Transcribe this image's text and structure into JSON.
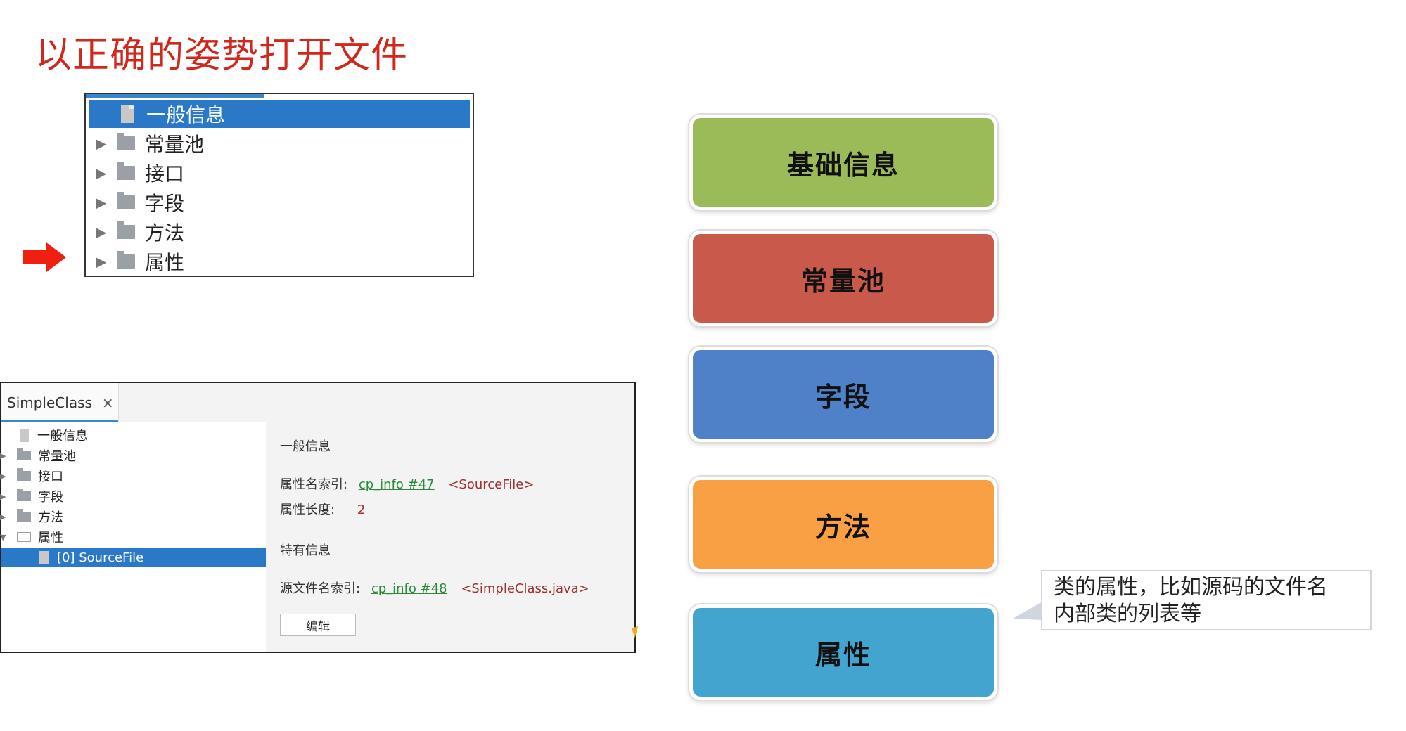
{
  "title": "以正确的姿势打开文件",
  "top_tree": {
    "items": [
      {
        "label": "一般信息",
        "type": "doc",
        "selected": true,
        "expandable": false
      },
      {
        "label": "常量池",
        "type": "folder",
        "selected": false,
        "expandable": true
      },
      {
        "label": "接口",
        "type": "folder",
        "selected": false,
        "expandable": true
      },
      {
        "label": "字段",
        "type": "folder",
        "selected": false,
        "expandable": true
      },
      {
        "label": "方法",
        "type": "folder",
        "selected": false,
        "expandable": true
      },
      {
        "label": "属性",
        "type": "folder",
        "selected": false,
        "expandable": true
      }
    ],
    "expander_glyph": "▶"
  },
  "window": {
    "tab_label": "SimpleClass",
    "tab_close": "×",
    "tree": [
      {
        "label": "一般信息",
        "type": "doc"
      },
      {
        "label": "常量池",
        "type": "folder",
        "expander": "▶"
      },
      {
        "label": "接口",
        "type": "folder",
        "expander": "▶"
      },
      {
        "label": "字段",
        "type": "folder",
        "expander": "▶"
      },
      {
        "label": "方法",
        "type": "folder",
        "expander": "▶"
      },
      {
        "label": "属性",
        "type": "folder-open",
        "expander": "▼"
      },
      {
        "label": "[0] SourceFile",
        "type": "doc",
        "selected": true
      }
    ],
    "general_section": "一般信息",
    "attr_name_index_label": "属性名索引:",
    "attr_name_index_link": "cp_info #47",
    "attr_name_index_value": "<SourceFile>",
    "attr_length_label": "属性长度:",
    "attr_length_value": "2",
    "specific_section": "特有信息",
    "source_file_index_label": "源文件名索引:",
    "source_file_index_link": "cp_info #48",
    "source_file_index_value": "<SimpleClass.java>",
    "edit_button": "编辑"
  },
  "blocks": [
    {
      "label": "基础信息",
      "color": "#9bbb59"
    },
    {
      "label": "常量池",
      "color": "#c9594a"
    },
    {
      "label": "字段",
      "color": "#4f81c8"
    },
    {
      "label": "方法",
      "color": "#f9a045"
    },
    {
      "label": "属性",
      "color": "#43a5cf"
    }
  ],
  "callout": {
    "line1": "类的属性，比如源码的文件名",
    "line2": "内部类的列表等"
  },
  "colors": {
    "title": "#d0281c",
    "selection": "#2a78c8",
    "arrow": "#f02010"
  }
}
